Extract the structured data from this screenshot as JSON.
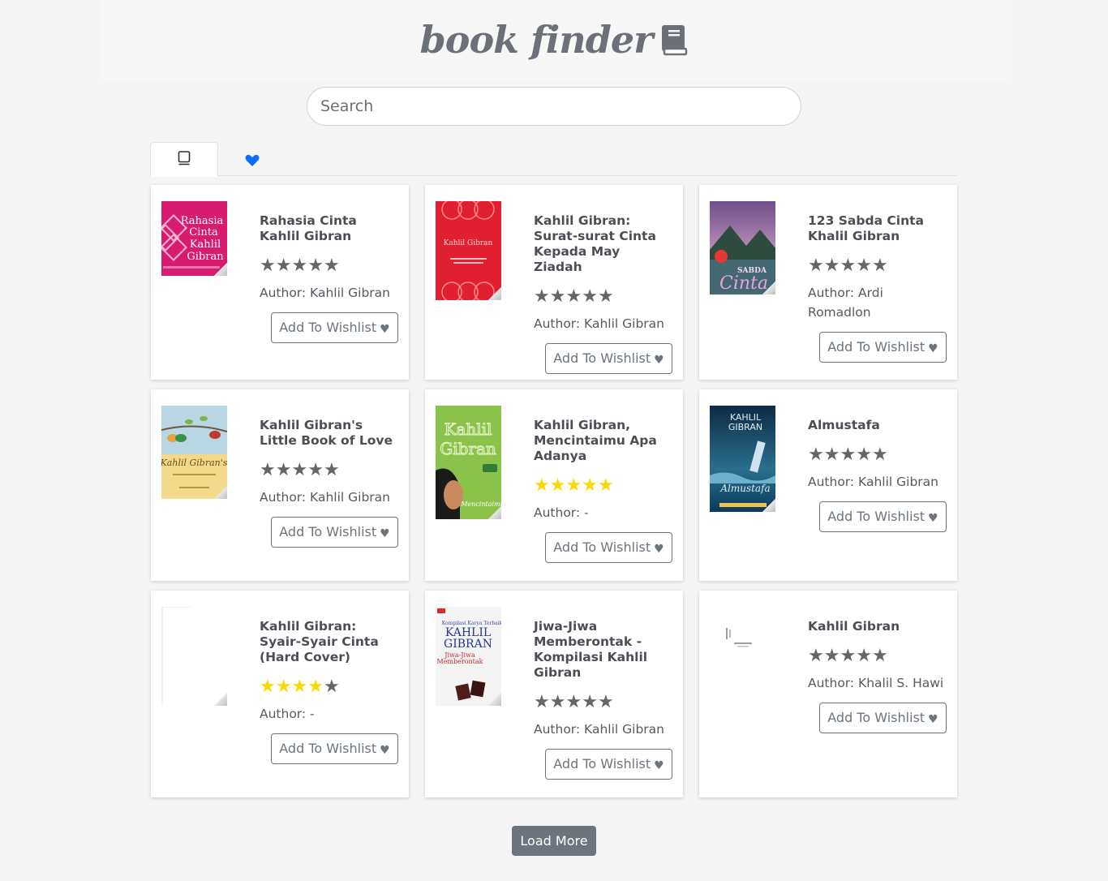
{
  "app": {
    "title": "book finder",
    "logo_icon": "book-icon"
  },
  "search": {
    "placeholder": "Search"
  },
  "tabs": [
    {
      "name": "books",
      "icon": "book-outline-icon",
      "active": true
    },
    {
      "name": "wishlist",
      "icon": "heart-icon",
      "active": false,
      "color": "#0d6efd"
    }
  ],
  "colors": {
    "star_on": "#ffd700",
    "star_off": "#666666",
    "button": "#6c757d"
  },
  "books": [
    {
      "title": "Rahasia Cinta Kahlil Gibran",
      "rating": 0,
      "author_label": "Author: Kahlil Gibran",
      "button": "Add To Wishlist",
      "cover_text": "Rahasia Cinta Kahlil Gibran"
    },
    {
      "title": "Kahlil Gibran: Surat-surat Cinta Kepada May Ziadah",
      "rating": 0,
      "author_label": "Author: Kahlil Gibran",
      "button": "Add To Wishlist",
      "cover_text": "Kahlil Gibran"
    },
    {
      "title": "123 Sabda Cinta Khalil Gibran",
      "rating": 0,
      "author_label": "Author: Ardi Romadlon",
      "button": "Add To Wishlist",
      "cover_text": "SABDA Cinta"
    },
    {
      "title": "Kahlil Gibran's Little Book of Love",
      "rating": 0,
      "author_label": "Author: Kahlil Gibran",
      "button": "Add To Wishlist",
      "cover_text": "Kahlil Gibran's"
    },
    {
      "title": "Kahlil Gibran, Mencintaimu Apa Adanya",
      "rating": 5,
      "author_label": "Author: -",
      "button": "Add To Wishlist",
      "cover_text": "Kahlil Gibran"
    },
    {
      "title": "Almustafa",
      "rating": 0,
      "author_label": "Author: Kahlil Gibran",
      "button": "Add To Wishlist",
      "cover_text": "KAHLIL GIBRAN"
    },
    {
      "title": "Kahlil Gibran: Syair-Syair Cinta (Hard Cover)",
      "rating": 4,
      "author_label": "Author: -",
      "button": "Add To Wishlist",
      "cover_text": ""
    },
    {
      "title": "Jiwa-Jiwa Memberontak - Kompilasi Kahlil Gibran",
      "rating": 0,
      "author_label": "Author: Kahlil Gibran",
      "button": "Add To Wishlist",
      "cover_text": "KAHLIL GIBRAN"
    },
    {
      "title": "Kahlil Gibran",
      "rating": 0,
      "author_label": "Author: Khalil S. Hawi",
      "button": "Add To Wishlist",
      "cover_text": ""
    }
  ],
  "load_more": "Load More"
}
